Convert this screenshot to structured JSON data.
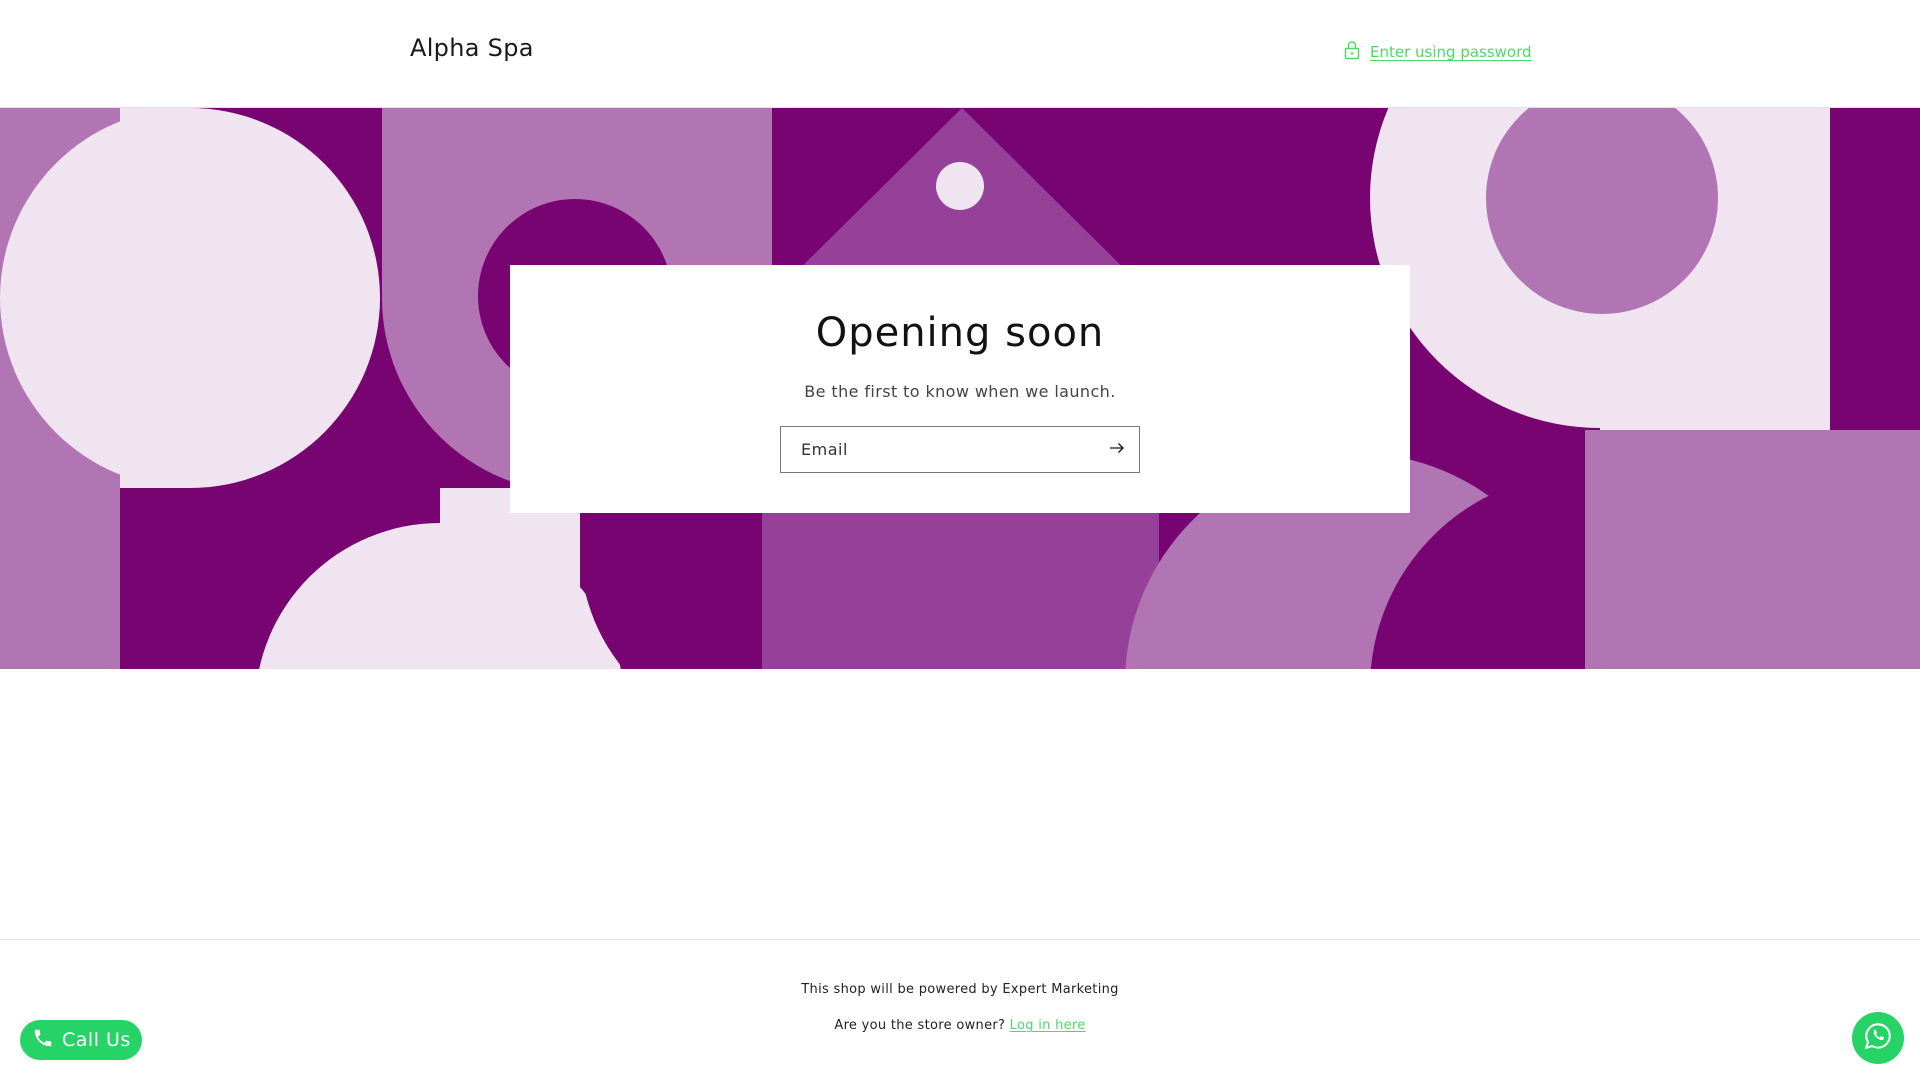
{
  "header": {
    "brand": "Alpha Spa",
    "password_link": "Enter using password",
    "lock_icon": "lock-icon"
  },
  "banner": {
    "colors": {
      "dark": "#770470",
      "medium": "#95419a",
      "light": "#b175b3",
      "pale": "#f0e4f0"
    }
  },
  "newsletter": {
    "title": "Opening soon",
    "subtitle": "Be the first to know when we launch.",
    "email_placeholder": "Email",
    "submit_icon": "arrow-right-icon"
  },
  "footer": {
    "powered_by": "This shop will be powered by Expert Marketing",
    "owner_prompt": "Are you the store owner?",
    "login_link": "Log in here"
  },
  "widgets": {
    "call_label": "Call Us",
    "call_icon": "phone-icon",
    "whatsapp_icon": "whatsapp-icon",
    "accent": "#25d366",
    "link_color": "#4cd964"
  }
}
